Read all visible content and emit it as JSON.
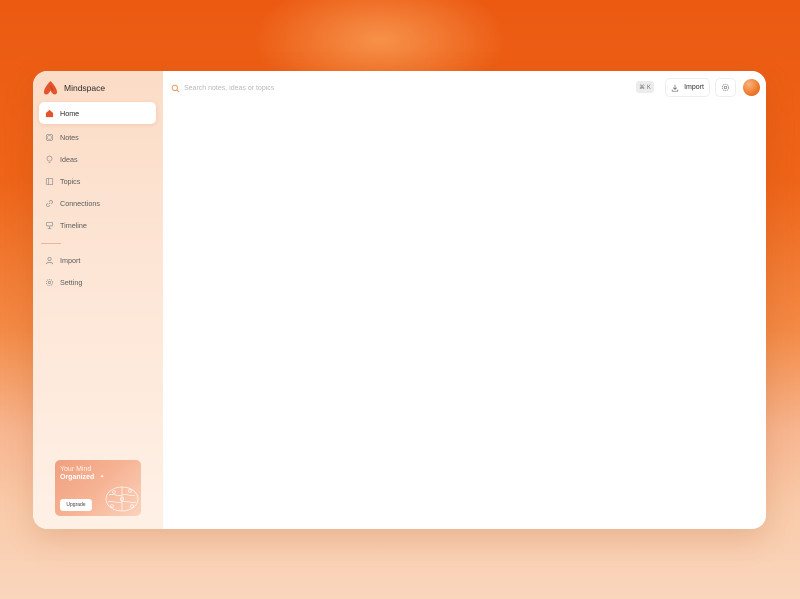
{
  "app": {
    "name": "Mindspace"
  },
  "sidebar": {
    "items": [
      {
        "label": "Home",
        "icon": "home-icon",
        "active": true
      },
      {
        "label": "Notes",
        "icon": "notes-icon"
      },
      {
        "label": "Ideas",
        "icon": "lightbulb-icon"
      },
      {
        "label": "Topics",
        "icon": "topics-icon"
      },
      {
        "label": "Connections",
        "icon": "link-icon"
      },
      {
        "label": "Timeline",
        "icon": "timeline-icon"
      }
    ],
    "secondary": [
      {
        "label": "Import",
        "icon": "user-icon"
      },
      {
        "label": "Setting",
        "icon": "gear-icon"
      }
    ]
  },
  "promo": {
    "line1": "Your Mind",
    "line2": "Organized",
    "button": "Upgrade"
  },
  "header": {
    "search_placeholder": "Search notes, ideas or topics",
    "shortcut": "⌘ K",
    "import_label": "Import"
  },
  "colors": {
    "accent": "#ee6418",
    "active_bg": "#ffffff",
    "sidebar_bg": "#fde6d6"
  }
}
